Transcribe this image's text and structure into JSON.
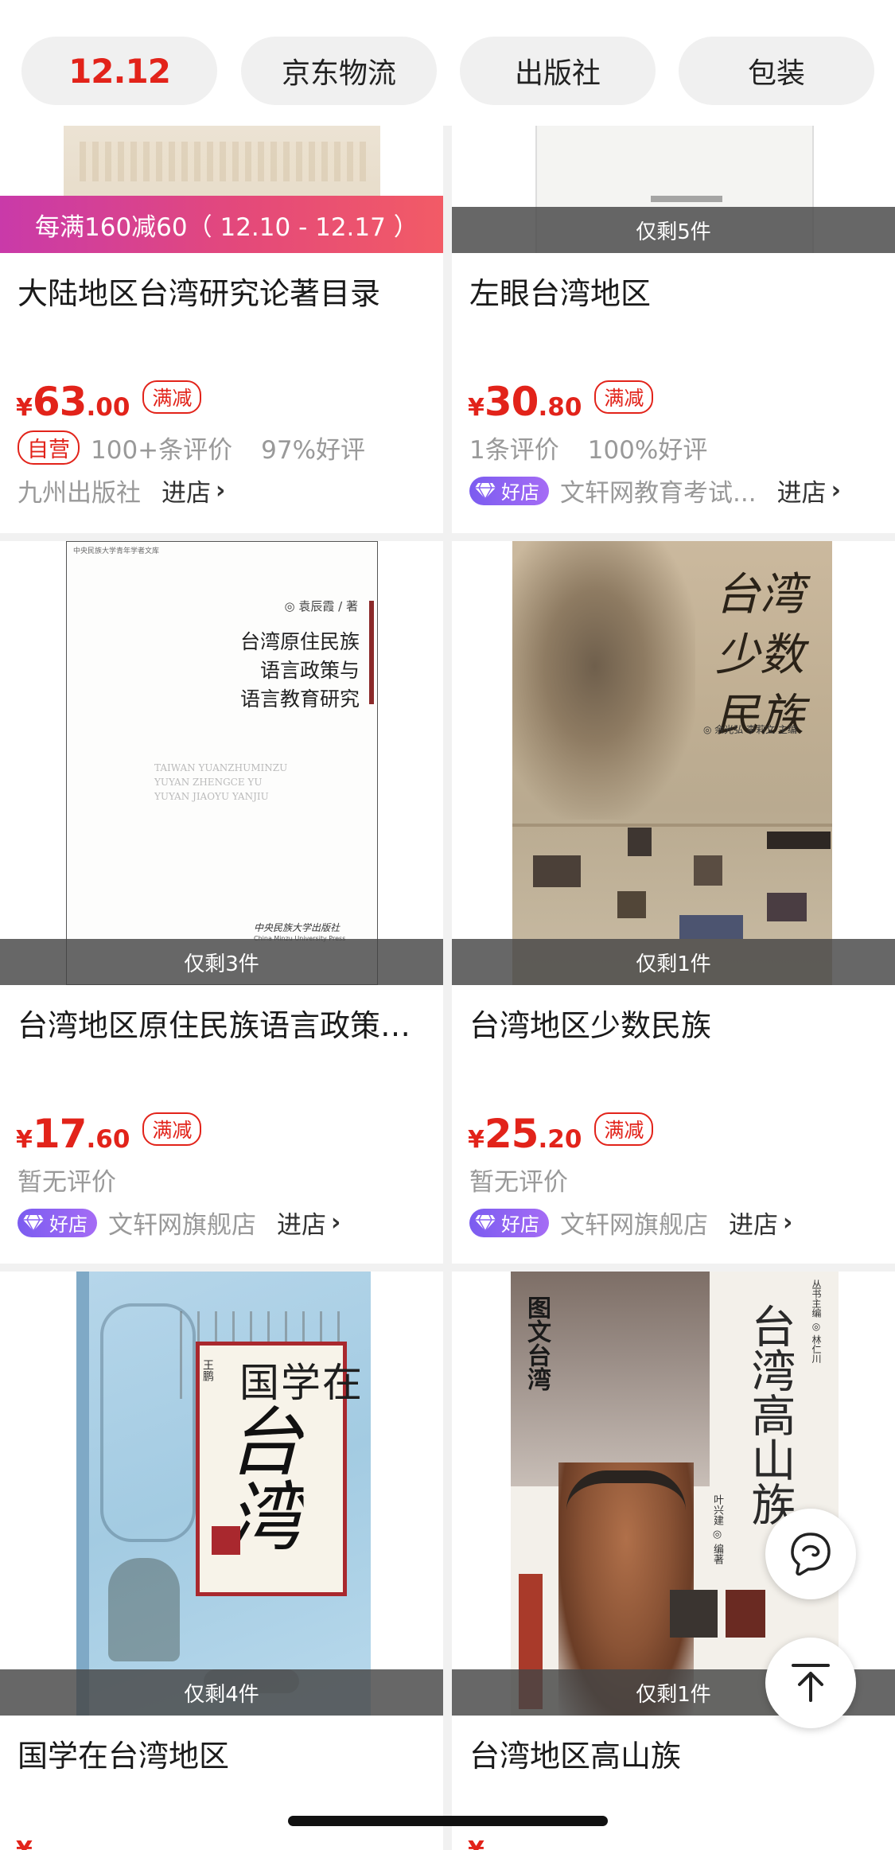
{
  "filters": [
    "12.12",
    "京东物流",
    "出版社",
    "包装"
  ],
  "promo_band": "每满160减60（ 12.10 - 12.17 ）",
  "cards": [
    {
      "title": "大陆地区台湾研究论著目录",
      "price_symbol": "¥",
      "price_int": "63",
      "price_dec": ".00",
      "tag": "满减",
      "self_badge": "自营",
      "reviews": "100+条评价",
      "rating": "97%好评",
      "store": "九州出版社",
      "enter": "进店"
    },
    {
      "title": "左眼台湾地区",
      "stock": "仅剩5件",
      "price_symbol": "¥",
      "price_int": "30",
      "price_dec": ".80",
      "tag": "满减",
      "reviews": "1条评价",
      "rating": "100%好评",
      "good_store": "好店",
      "store": "文轩网教育考试...",
      "enter": "进店"
    },
    {
      "title": "台湾地区原住民族语言政策与语言教育研究",
      "stock": "仅剩3件",
      "price_symbol": "¥",
      "price_int": "17",
      "price_dec": ".60",
      "tag": "满减",
      "reviews": "暂无评价",
      "good_store": "好店",
      "store": "文轩网旗舰店",
      "enter": "进店",
      "cover": {
        "series": "中央民族大学青年学者文库",
        "author": "◎ 袁辰霞 / 著",
        "lines": [
          "台湾原住民族",
          "语言政策与",
          "语言教育研究"
        ],
        "pinyin": [
          "TAIWAN YUANZHUMINZU",
          "YUYAN ZHENGCE YU",
          "YUYAN JIAOYU YANJIU"
        ],
        "publisher": "中央民族大学出版社",
        "publisher_en": "China Minzu University Press"
      }
    },
    {
      "title": "台湾地区少数民族",
      "stock": "仅剩1件",
      "price_symbol": "¥",
      "price_int": "25",
      "price_dec": ".20",
      "tag": "满减",
      "reviews": "暂无评价",
      "good_store": "好店",
      "store": "文轩网旗舰店",
      "enter": "进店",
      "cover": {
        "lines": [
          "台湾",
          "少数",
          "民族"
        ],
        "editors": "◎ 余光弘 李莉文 主编"
      }
    },
    {
      "title": "国学在台湾地区",
      "stock": "仅剩4件",
      "cover": {
        "title_a": "国学在",
        "title_b": "台湾",
        "author": "王鹏"
      }
    },
    {
      "title": "台湾地区高山族",
      "stock": "仅剩1件",
      "cover": {
        "title": "台湾高山族",
        "series_side": "丛书主编 ◎ 林仁川",
        "author": "叶兴建 ◎ 编著",
        "corner": "图文台湾"
      }
    }
  ],
  "icons": {
    "service": "customer-service-icon",
    "top": "back-to-top-icon"
  },
  "colors": {
    "accent": "#e2231a",
    "good_store": "#8a63f2",
    "stock_band": "#464646"
  }
}
